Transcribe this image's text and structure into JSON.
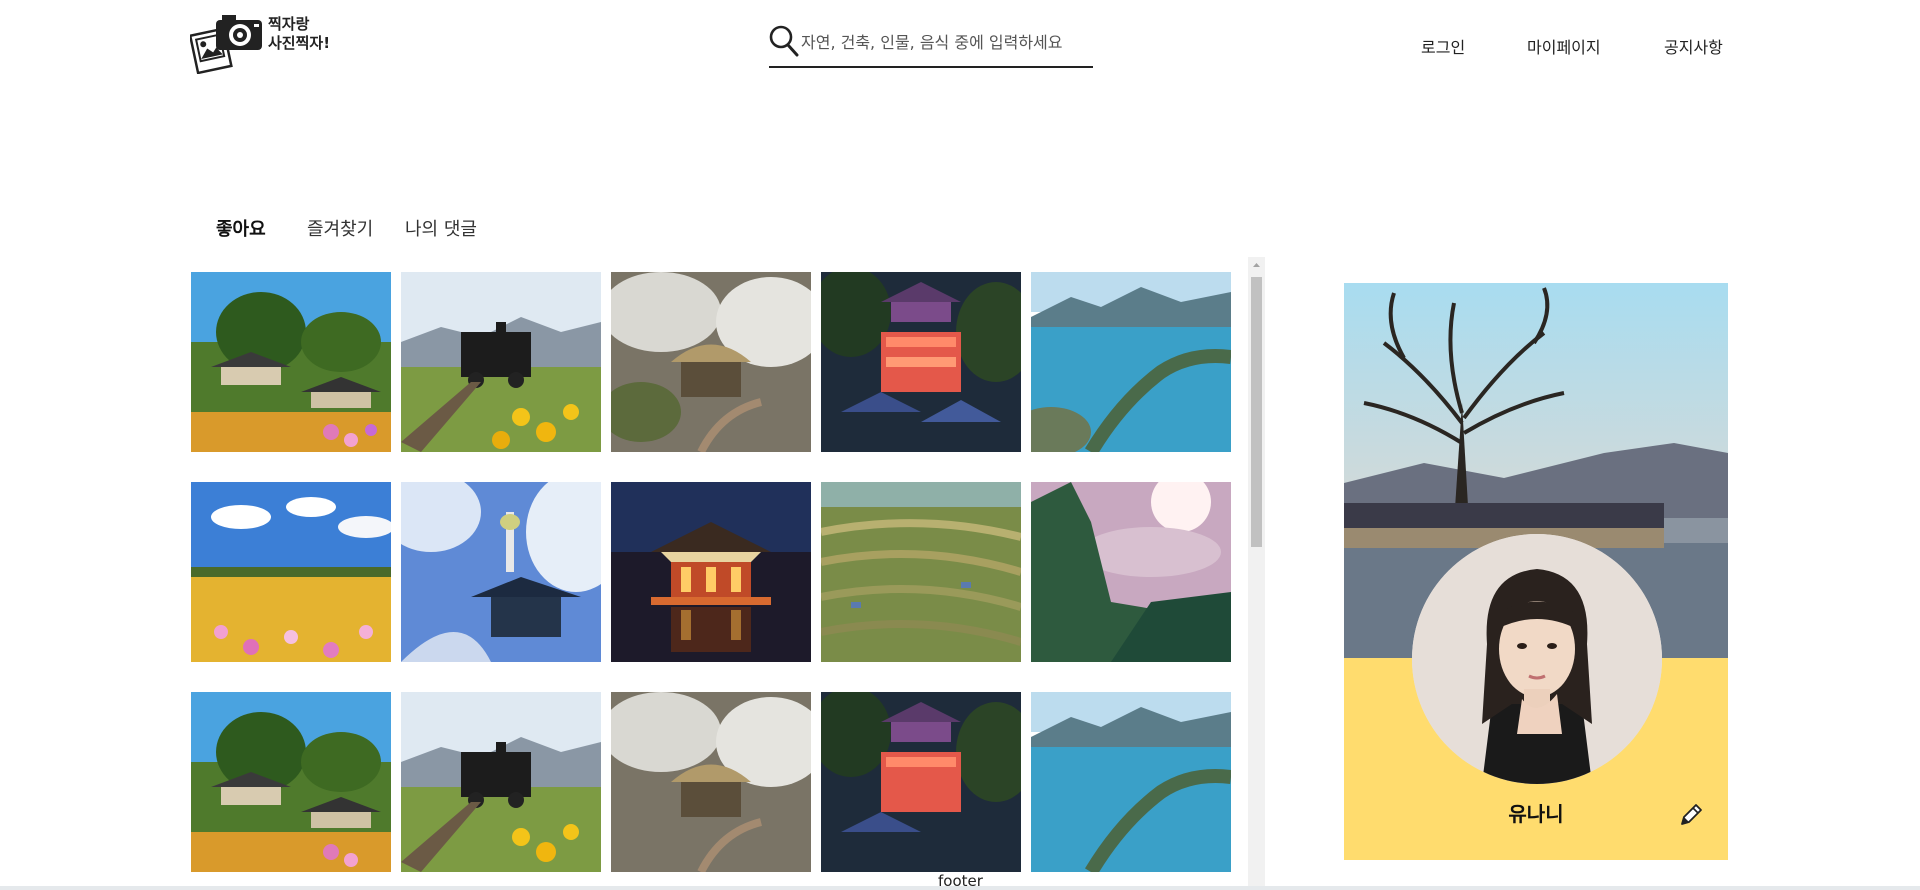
{
  "header": {
    "logo_line1": "찍자랑",
    "logo_line2": "사진찍자!",
    "search": {
      "placeholder": "자연, 건축, 인물, 음식 중에 입력하세요"
    },
    "nav": {
      "login": "로그인",
      "mypage": "마이페이지",
      "notice": "공지사항"
    }
  },
  "tabs": [
    {
      "label": "좋아요",
      "active": true
    },
    {
      "label": "즐겨찾기",
      "active": false
    },
    {
      "label": "나의 댓글",
      "active": false
    }
  ],
  "grid": {
    "photos": [
      "hanok-village-icon",
      "steam-train-sunflower-icon",
      "thatched-hut-plum-blossom-icon",
      "temple-lanterns-night-icon",
      "coastal-island-icon",
      "cosmos-field-icon",
      "snowy-pavilion-tower-icon",
      "pavilion-night-reflection-icon",
      "terraced-fields-icon",
      "misty-cliff-sunrise-icon",
      "hanok-village-icon",
      "steam-train-sunflower-icon",
      "thatched-hut-plum-blossom-icon",
      "temple-lanterns-night-icon",
      "coastal-island-icon"
    ]
  },
  "profile": {
    "username": "유나니",
    "accent_color": "#ffdc6e"
  },
  "footer": {
    "label": "footer"
  }
}
